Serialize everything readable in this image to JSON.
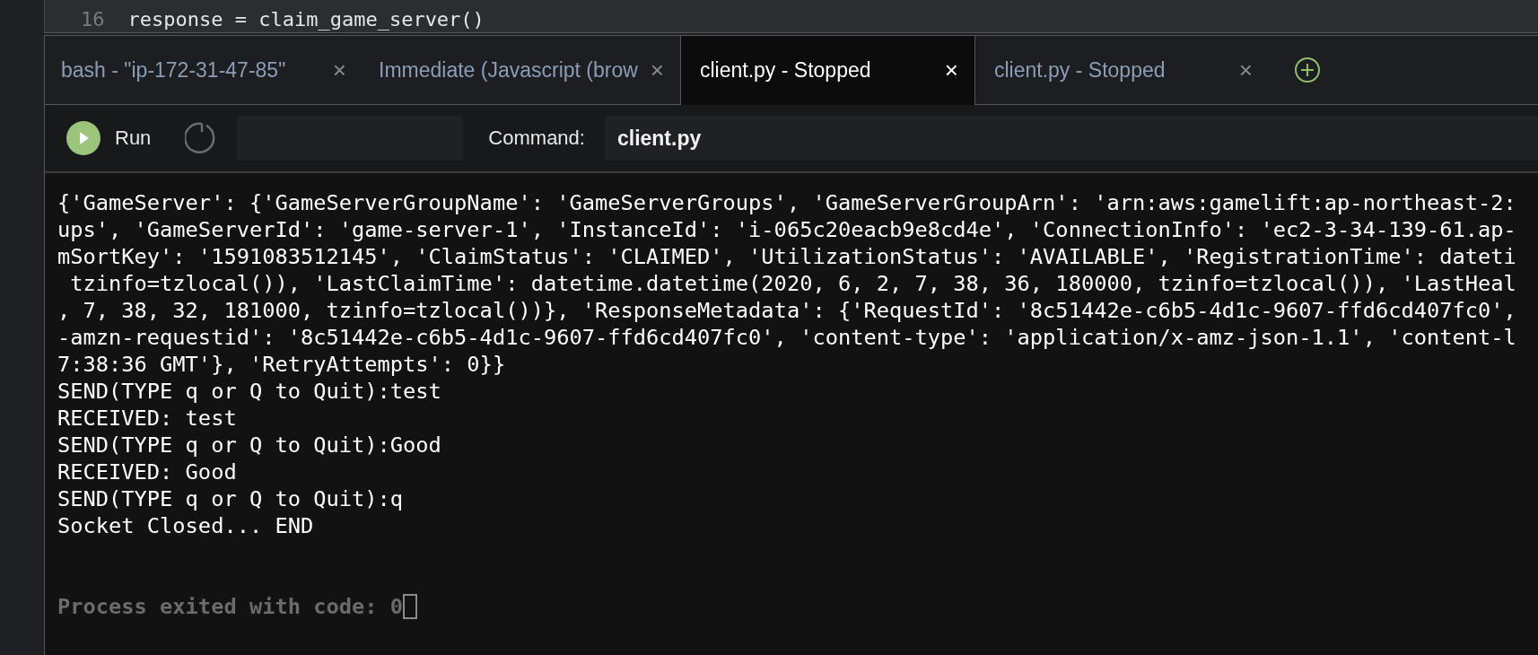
{
  "editor": {
    "line_number": "16",
    "code": "response = claim_game_server()"
  },
  "tabs": [
    {
      "label": "bash - \"ip-172-31-47-85\"",
      "close": "×",
      "selected": false
    },
    {
      "label": "Immediate (Javascript (brow",
      "close": "×",
      "selected": false
    },
    {
      "label": "client.py - Stopped",
      "close": "×",
      "selected": true
    },
    {
      "label": "client.py - Stopped",
      "close": "×",
      "selected": false
    }
  ],
  "toolbar": {
    "run_label": "Run",
    "command_label": "Command:",
    "command_value": "client.py"
  },
  "terminal": {
    "lines": [
      "{'GameServer': {'GameServerGroupName': 'GameServerGroups', 'GameServerGroupArn': 'arn:aws:gamelift:ap-northeast-2:",
      "ups', 'GameServerId': 'game-server-1', 'InstanceId': 'i-065c20eacb9e8cd4e', 'ConnectionInfo': 'ec2-3-34-139-61.ap-",
      "mSortKey': '1591083512145', 'ClaimStatus': 'CLAIMED', 'UtilizationStatus': 'AVAILABLE', 'RegistrationTime': dateti",
      " tzinfo=tzlocal()), 'LastClaimTime': datetime.datetime(2020, 6, 2, 7, 38, 36, 180000, tzinfo=tzlocal()), 'LastHeal",
      ", 7, 38, 32, 181000, tzinfo=tzlocal())}, 'ResponseMetadata': {'RequestId': '8c51442e-c6b5-4d1c-9607-ffd6cd407fc0',",
      "-amzn-requestid': '8c51442e-c6b5-4d1c-9607-ffd6cd407fc0', 'content-type': 'application/x-amz-json-1.1', 'content-l",
      "7:38:36 GMT'}, 'RetryAttempts': 0}}",
      "SEND(TYPE q or Q to Quit):test",
      "RECEIVED: test",
      "SEND(TYPE q or Q to Quit):Good",
      "RECEIVED: Good",
      "SEND(TYPE q or Q to Quit):q",
      "Socket Closed... END"
    ],
    "exit_message": "Process exited with code: 0"
  }
}
